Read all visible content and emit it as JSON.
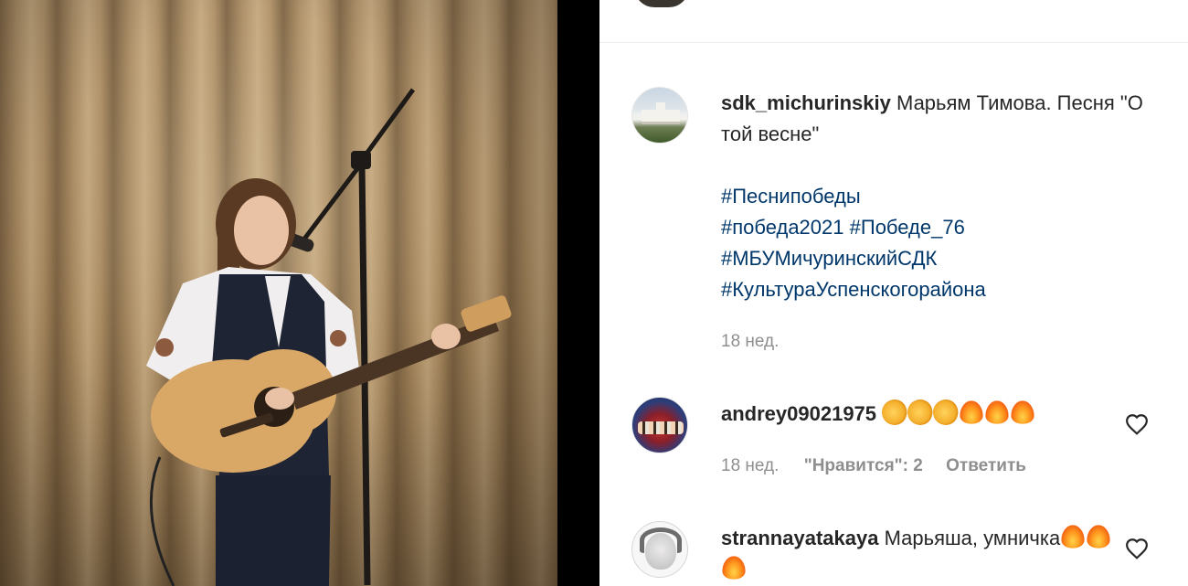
{
  "post": {
    "username": "sdk_michurinskiy",
    "caption": "Марьям Тимова. Песня \"О той весне\"",
    "hashtags": [
      "#Песнипобеды",
      "#победа2021",
      "#Победе_76",
      "#МБУМичуринскийСДК",
      "#КультураУспенскогорайона"
    ],
    "time": "18 нед."
  },
  "comments": [
    {
      "username": "andrey09021975",
      "text": "",
      "emojis": [
        "clapping-hands",
        "clapping-hands",
        "clapping-hands",
        "fire",
        "fire",
        "fire"
      ],
      "time": "18 нед.",
      "likes_label": "\"Нравится\": 2",
      "reply_label": "Ответить"
    },
    {
      "username": "strannayatakaya",
      "text": "Марьяша, умничка",
      "emojis": [
        "fire",
        "fire",
        "fire"
      ]
    }
  ],
  "colors": {
    "hashtag": "#00376b",
    "meta": "#8e8e8e",
    "text": "#262626"
  }
}
